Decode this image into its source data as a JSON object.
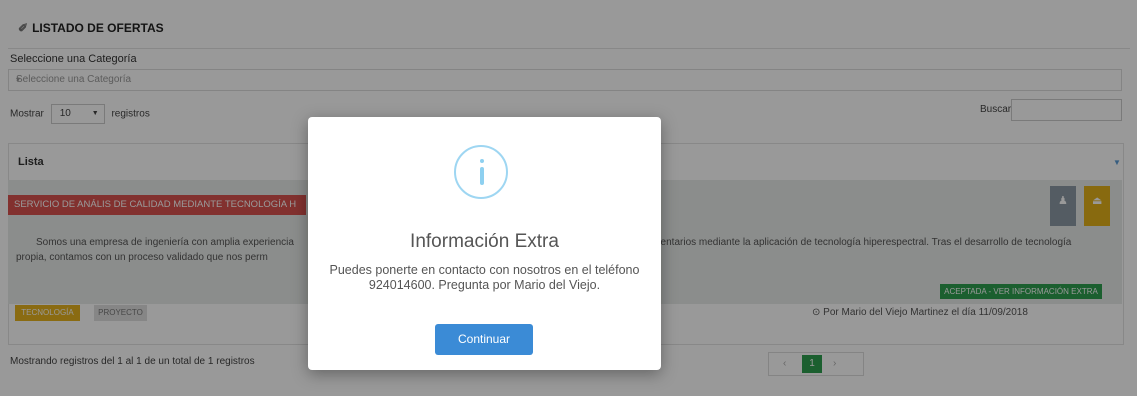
{
  "header": {
    "title": "LISTADO DE OFERTAS",
    "title_icon": "pin-icon"
  },
  "category": {
    "label": "Seleccione una Categoría",
    "placeholder": "Seleccione una Categoría"
  },
  "table_controls": {
    "show_prefix": "Mostrar",
    "length_value": "10",
    "show_suffix": "registros",
    "search_label": "Buscar:",
    "search_value": ""
  },
  "list": {
    "title": "Lista"
  },
  "offer": {
    "ribbon": "SERVICIO DE ANÁLIS DE CALIDAD MEDIANTE TECNOLOGÍA H",
    "desc_line1_left": "Somos una empresa de ingeniería con amplia experiencia",
    "desc_line1_right": "imentarios mediante la aplicación de tecnología hiperespectral. Tras el desarrollo de tecnología",
    "desc_line2": "propia, contamos con un proceso validado que nos perm",
    "extra_button": "ACEPTADA - VER INFORMACIÓN EXTRA",
    "tags": [
      "TECNOLOGÍA",
      "PROYECTO"
    ],
    "author": "⊙ Por Mario del Viejo Martinez el día 11/09/2018",
    "colors": {
      "ribbon": "#d9534f",
      "accept": "#2e9e4f",
      "tag_tech": "#e6b31e"
    }
  },
  "footer": {
    "info": "Mostrando registros del 1 al 1 de un total de 1 registros",
    "pagination": {
      "prev": "‹",
      "current": "1",
      "next": "›"
    }
  },
  "modal": {
    "icon": "info-icon",
    "title": "Información Extra",
    "text": "Puedes ponerte en contacto con nosotros en el teléfono 924014600. Pregunta por Mario del Viejo.",
    "button": "Continuar"
  }
}
